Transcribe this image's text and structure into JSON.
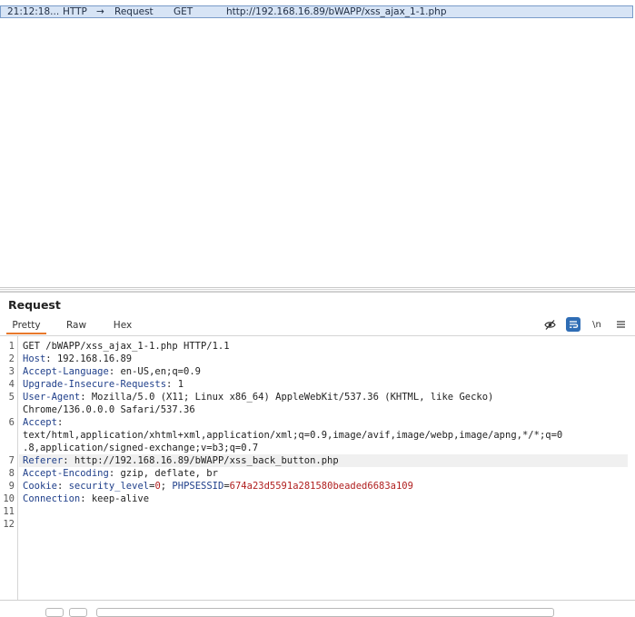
{
  "history": {
    "time": "21:12:18...",
    "protocol": "HTTP",
    "direction_arrow": "→",
    "type": "Request",
    "method": "GET",
    "url": "http://192.168.16.89/bWAPP/xss_ajax_1-1.php"
  },
  "panel": {
    "title": "Request",
    "tabs": [
      "Pretty",
      "Raw",
      "Hex"
    ],
    "active_tab": "Pretty",
    "newline_label": "\\n",
    "icons": [
      "hide-eye-icon",
      "wrap-lines-icon",
      "newline-icon",
      "menu-icon"
    ],
    "accent_color": "#e8792c"
  },
  "request": {
    "line_numbers": [
      "1",
      "2",
      "3",
      "4",
      "5",
      "6",
      "7",
      "8",
      "9",
      "10",
      "11",
      "12"
    ],
    "line1": "GET /bWAPP/xss_ajax_1-1.php HTTP/1.1",
    "host_key": "Host",
    "host_val": ": 192.168.16.89",
    "lang_key": "Accept-Language",
    "lang_val": ": en-US,en;q=0.9",
    "upgrade_key": "Upgrade-Insecure-Requests",
    "upgrade_val": ": 1",
    "ua_key": "User-Agent",
    "ua_val": ": Mozilla/5.0 (X11; Linux x86_64) AppleWebKit/537.36 (KHTML, like Gecko)",
    "ua_cont": "Chrome/136.0.0.0 Safari/537.36",
    "accept_key": "Accept",
    "accept_colon": ":",
    "accept_val1": "text/html,application/xhtml+xml,application/xml;q=0.9,image/avif,image/webp,image/apng,*/*;q=0",
    "accept_val2": ".8,application/signed-exchange;v=b3;q=0.7",
    "referer_key": "Referer",
    "referer_val": ": http://192.168.16.89/bWAPP/xss_back_button.php",
    "encoding_key": "Accept-Encoding",
    "encoding_val": ": gzip, deflate, br",
    "cookie_key": "Cookie",
    "cookie_colon": ": ",
    "cookie_name1": "security_level",
    "cookie_eq1": "=",
    "cookie_val1": "0",
    "cookie_sep": "; ",
    "cookie_name2": "PHPSESSID",
    "cookie_eq2": "=",
    "cookie_val2": "674a23d5591a281580beaded6683a109",
    "conn_key": "Connection",
    "conn_val": ": keep-alive"
  }
}
